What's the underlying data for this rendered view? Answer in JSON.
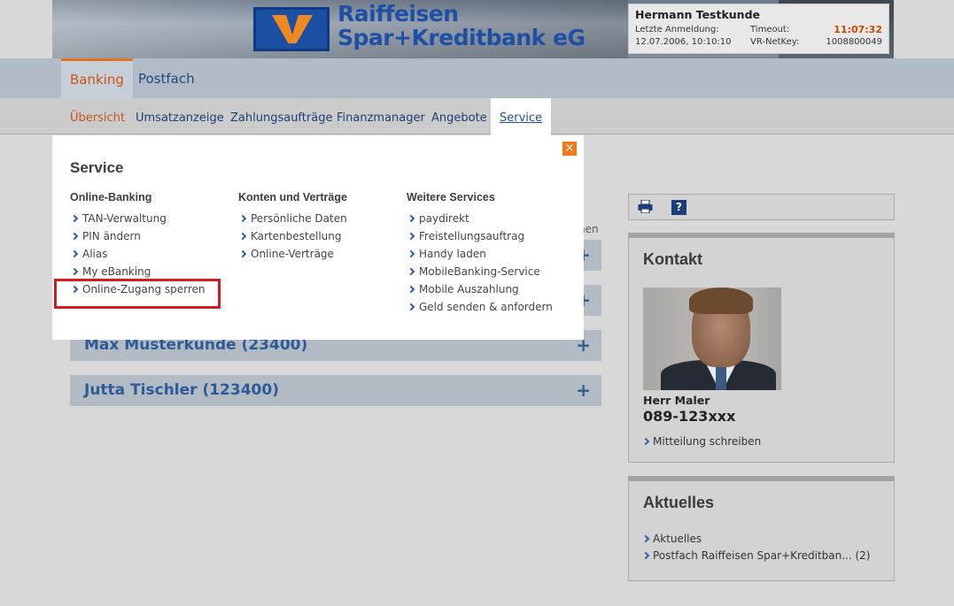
{
  "header": {
    "bank_name_line1": "Raiffeisen",
    "bank_name_line2": "Spar+Kreditbank eG",
    "user": {
      "name": "Hermann Testkunde",
      "last_login_label": "Letzte Anmeldung:",
      "last_login_value": "12.07.2006, 10:10:10",
      "timeout_label": "Timeout:",
      "timeout_value": "11:07:32",
      "netkey_label": "VR-NetKey:",
      "netkey_value": "1008800049"
    }
  },
  "main_nav": {
    "tabs": [
      {
        "label": "Banking",
        "active": true
      },
      {
        "label": "Postfach",
        "active": false
      }
    ]
  },
  "sub_nav": {
    "items": [
      {
        "label": "Übersicht"
      },
      {
        "label": "Umsatzanzeige"
      },
      {
        "label": "Zahlungsaufträge"
      },
      {
        "label": "Finanzmanager"
      },
      {
        "label": "Angebote"
      },
      {
        "label": "Service",
        "active": true
      }
    ]
  },
  "content": {
    "stub_text": "hen",
    "accounts": [
      {
        "name": "Max Musterkunde (23400)"
      },
      {
        "name": "Jutta Tischler (123400)"
      }
    ],
    "expand_symbol": "+"
  },
  "toolbar": {
    "help_label": "?"
  },
  "contact": {
    "title": "Kontakt",
    "person_name": "Herr Maler",
    "phone": "089-123xxx",
    "link": "Mitteilung schreiben"
  },
  "news": {
    "title": "Aktuelles",
    "links": [
      "Aktuelles",
      "Postfach Raiffeisen Spar+Kreditban... (2)"
    ]
  },
  "service_menu": {
    "title": "Service",
    "close_label": "×",
    "columns": [
      {
        "heading": "Online-Banking",
        "links": [
          "TAN-Verwaltung",
          "PIN ändern",
          "Alias",
          "My eBanking",
          "Online-Zugang sperren"
        ]
      },
      {
        "heading": "Konten und Verträge",
        "links": [
          "Persönliche Daten",
          "Kartenbestellung",
          "Online-Verträge"
        ]
      },
      {
        "heading": "Weitere Services",
        "links": [
          "paydirekt",
          "Freistellungsauftrag",
          "Handy laden",
          "MobileBanking-Service",
          "Mobile Auszahlung",
          "Geld senden & anfordern"
        ]
      }
    ]
  },
  "colors": {
    "accent_orange": "#e07024",
    "brand_blue": "#1f4fa5",
    "highlight_red": "#d71920"
  }
}
